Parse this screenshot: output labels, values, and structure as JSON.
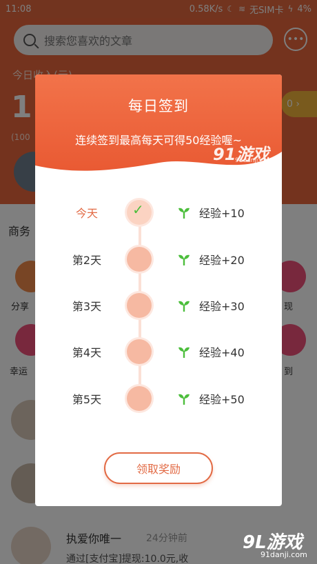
{
  "status_bar": {
    "time": "11:08",
    "net_speed": "0.58K/s",
    "sim": "无SIM卡",
    "battery": "4%"
  },
  "app": {
    "search_placeholder": "搜索您喜欢的文章",
    "today_income_label": "今日收入(元)",
    "big_number": "1",
    "sub_number": "(100",
    "section_title": "商务",
    "grid_labels": [
      "分享",
      "现",
      "幸运",
      "到"
    ],
    "feed": {
      "name": "执爱你唯一",
      "time": "24分钟前",
      "text": "通过[支付宝]提现:10.0元,收"
    }
  },
  "modal": {
    "title": "每日签到",
    "subtitle": "连续签到最高每天可得50经验喔~",
    "days": [
      {
        "label": "今天",
        "reward": "经验+10",
        "checked": true
      },
      {
        "label": "第2天",
        "reward": "经验+20",
        "checked": false
      },
      {
        "label": "第3天",
        "reward": "经验+30",
        "checked": false
      },
      {
        "label": "第4天",
        "reward": "经验+40",
        "checked": false
      },
      {
        "label": "第5天",
        "reward": "经验+50",
        "checked": false
      }
    ],
    "claim_button": "领取奖励",
    "check_glyph": "✓"
  },
  "watermark": {
    "top_logo": "91游戏",
    "top_url": "91danji.com",
    "bottom_logo": "9L游戏",
    "bottom_url": "91danji.com"
  },
  "colors": {
    "accent": "#e26a44",
    "header_top": "#f2734a",
    "sprout": "#4cbe3c",
    "dot": "#f6b9a2"
  },
  "icons": {
    "search": "search-icon",
    "message": "message-icon",
    "check": "check-icon",
    "sprout": "sprout-icon"
  }
}
